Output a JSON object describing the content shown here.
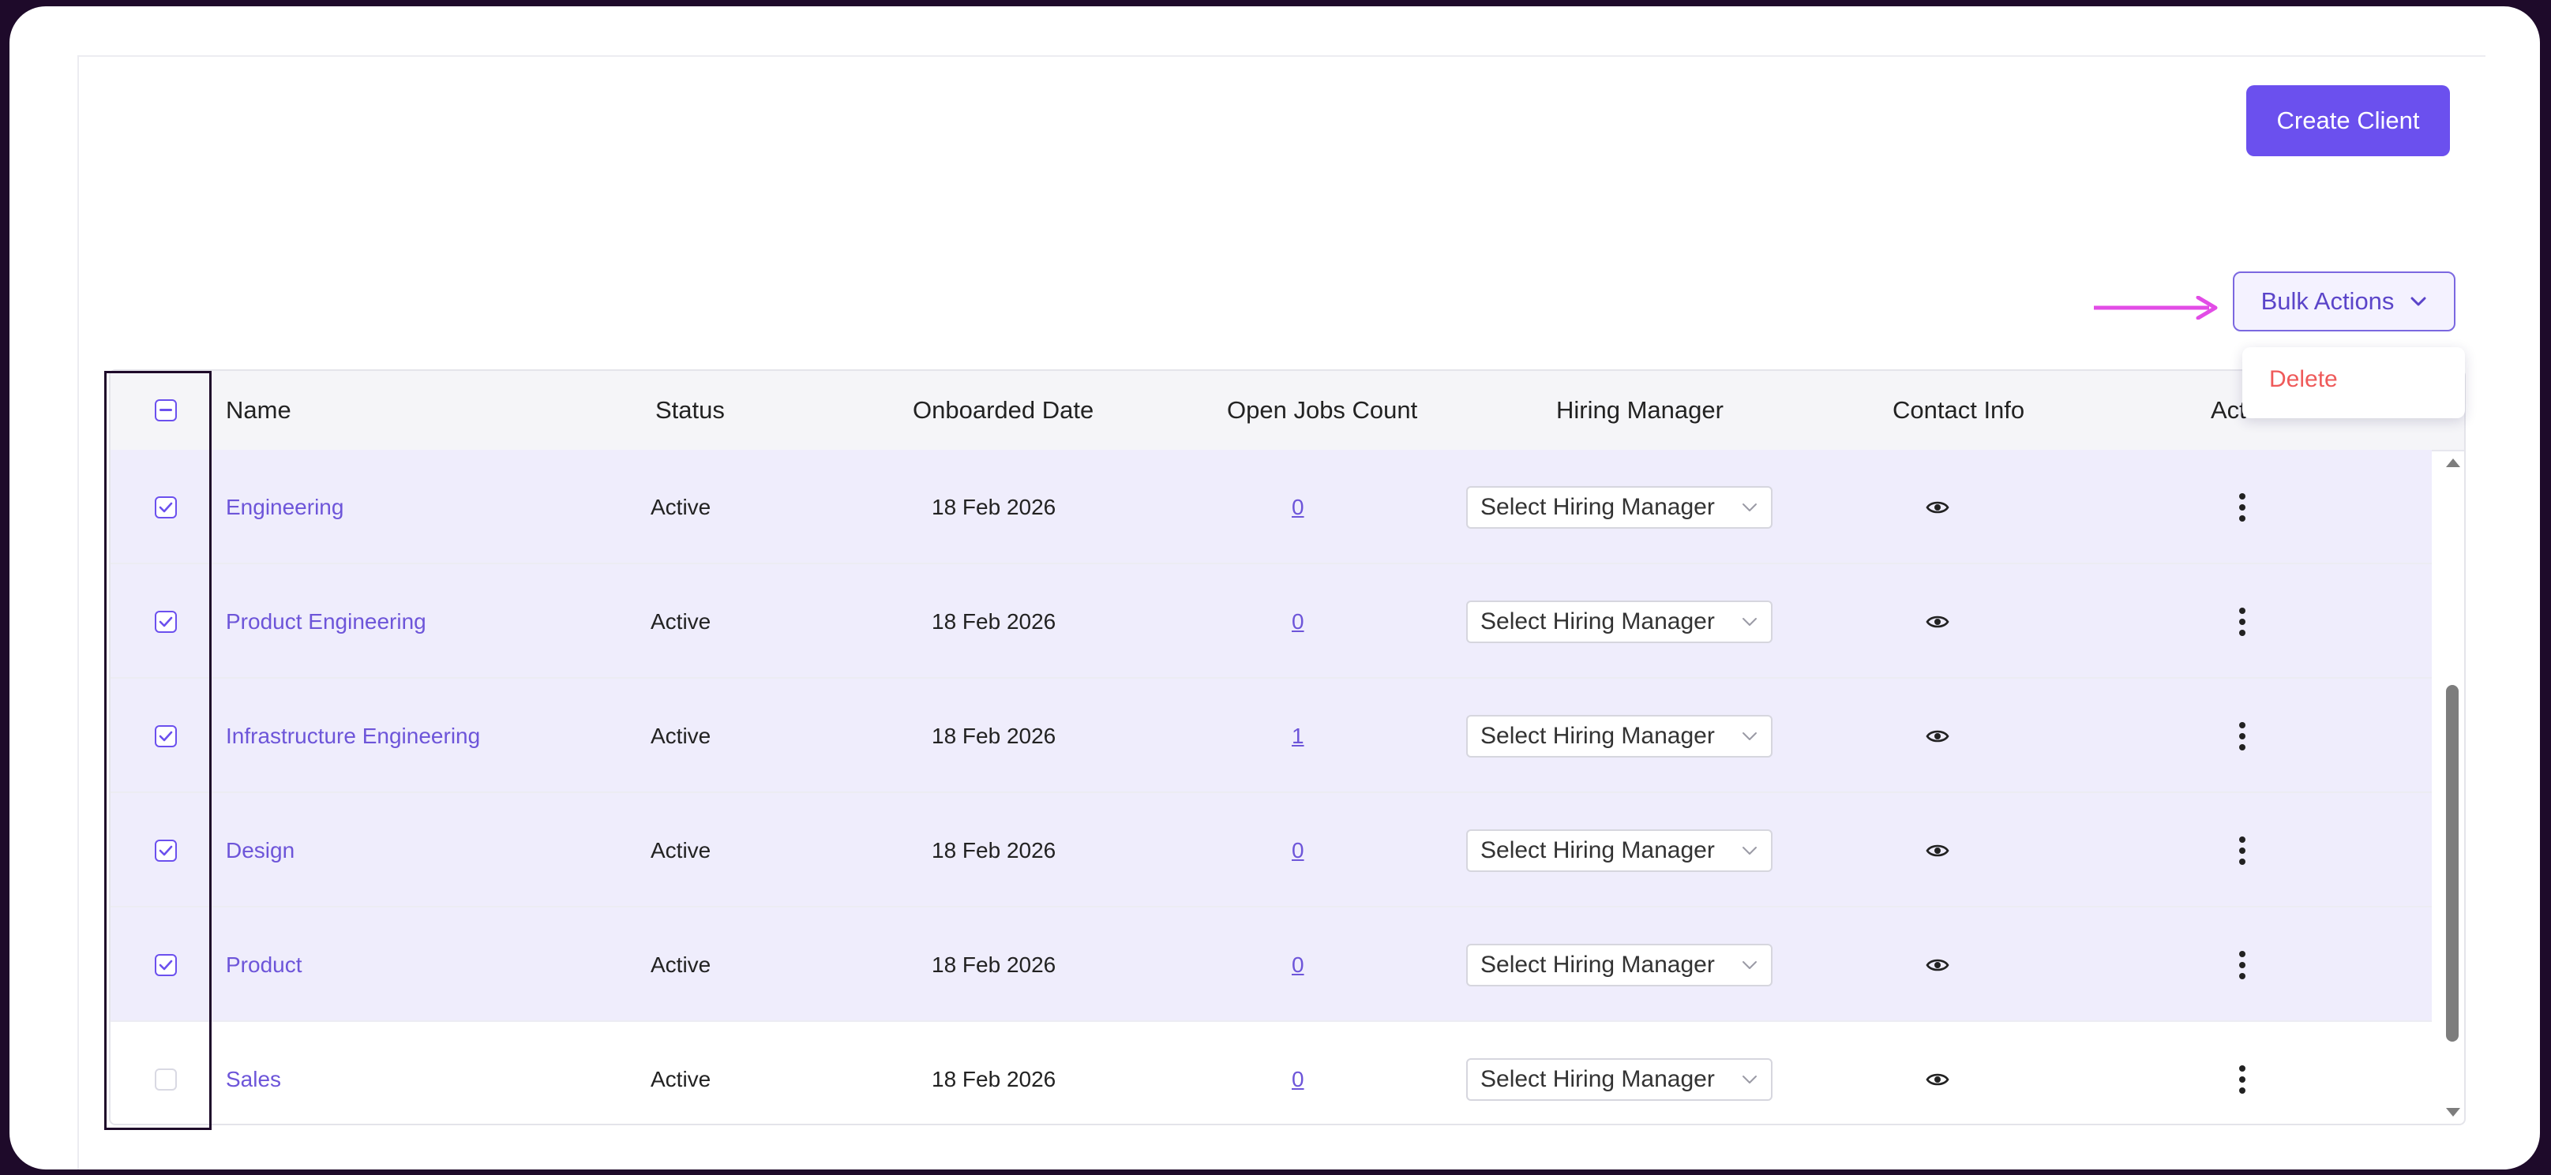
{
  "toolbar": {
    "create_client_label": "Create Client",
    "bulk_actions_label": "Bulk Actions",
    "bulk_menu": [
      {
        "label": "Delete",
        "color": "#ef5a5a"
      }
    ]
  },
  "table": {
    "columns": [
      "Name",
      "Status",
      "Onboarded Date",
      "Open Jobs Count",
      "Hiring Manager",
      "Contact Info",
      "Act"
    ],
    "rows": [
      {
        "checked": true,
        "name": "Engineering",
        "status": "Active",
        "onboarded": "18 Feb 2026",
        "open_jobs": "0",
        "hiring_manager": "Select Hiring Manager"
      },
      {
        "checked": true,
        "name": "Product Engineering",
        "status": "Active",
        "onboarded": "18 Feb 2026",
        "open_jobs": "0",
        "hiring_manager": "Select Hiring Manager"
      },
      {
        "checked": true,
        "name": "Infrastructure Engineering",
        "status": "Active",
        "onboarded": "18 Feb 2026",
        "open_jobs": "1",
        "hiring_manager": "Select Hiring Manager"
      },
      {
        "checked": true,
        "name": "Design",
        "status": "Active",
        "onboarded": "18 Feb 2026",
        "open_jobs": "0",
        "hiring_manager": "Select Hiring Manager"
      },
      {
        "checked": true,
        "name": "Product",
        "status": "Active",
        "onboarded": "18 Feb 2026",
        "open_jobs": "0",
        "hiring_manager": "Select Hiring Manager"
      },
      {
        "checked": false,
        "name": "Sales",
        "status": "Active",
        "onboarded": "18 Feb 2026",
        "open_jobs": "0",
        "hiring_manager": "Select Hiring Manager"
      }
    ]
  },
  "theme": {
    "accent": "#6b50ee",
    "selected_row_bg": "#efedfc",
    "danger": "#ef5a5a",
    "annotation_arrow": "#e24ce6"
  },
  "icons": {
    "select_all": "minus-square-icon",
    "row_checkbox": "check-icon",
    "contact": "eye-icon",
    "actions": "kebab-menu-icon",
    "dropdown": "chevron-down-icon"
  }
}
